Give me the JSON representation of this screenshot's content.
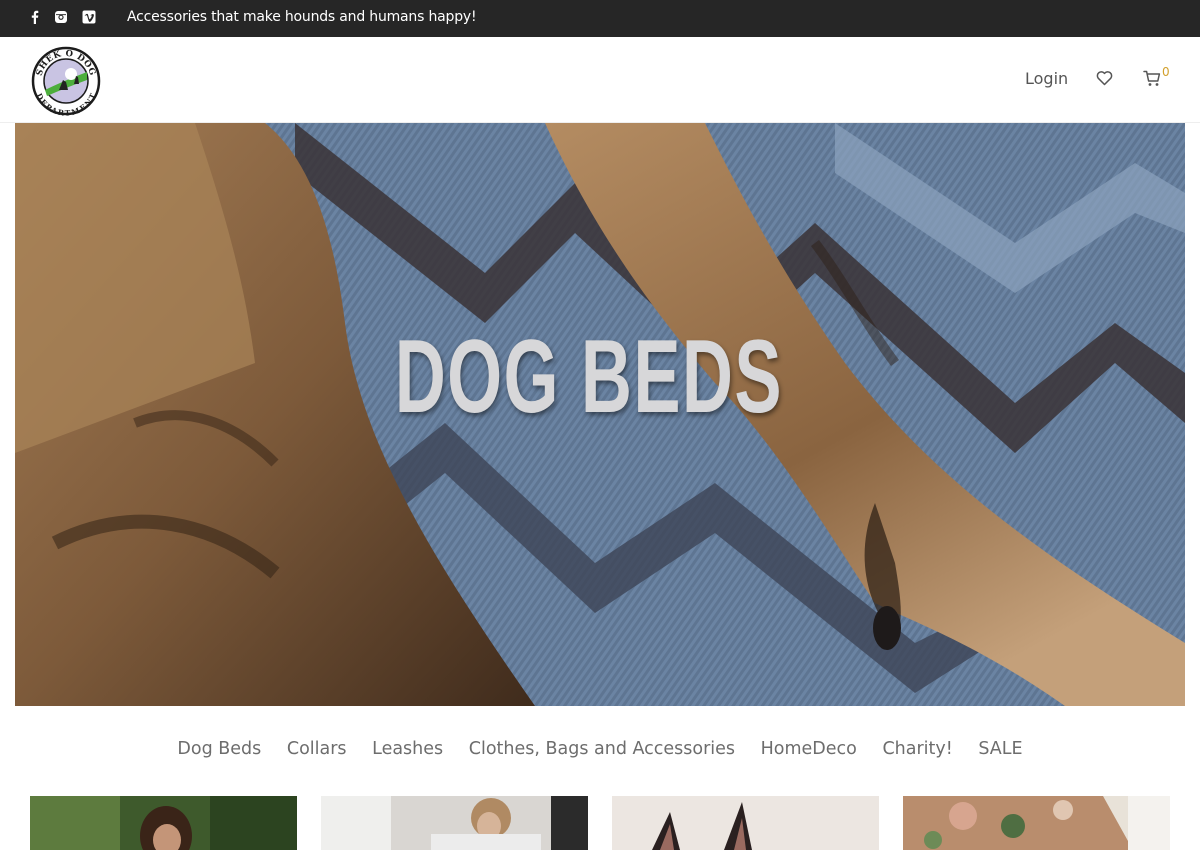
{
  "topbar": {
    "tagline": "Accessories that make hounds and humans happy!",
    "social": [
      "facebook-icon",
      "instagram-icon",
      "vimeo-icon"
    ]
  },
  "header": {
    "logo_text_top": "SHEK O DOG",
    "logo_text_bottom": "DEPARTMENT",
    "login_label": "Login",
    "cart_count": "0"
  },
  "hero": {
    "title": "DOG BEDS"
  },
  "categories": [
    {
      "label": "Dog Beds"
    },
    {
      "label": "Collars"
    },
    {
      "label": "Leashes"
    },
    {
      "label": "Clothes, Bags and Accessories"
    },
    {
      "label": "HomeDeco"
    },
    {
      "label": "Charity!"
    },
    {
      "label": "SALE"
    }
  ],
  "colors": {
    "topbar_bg": "#262626",
    "accent": "#d2a02c",
    "nav_text": "#6d6d6d"
  }
}
